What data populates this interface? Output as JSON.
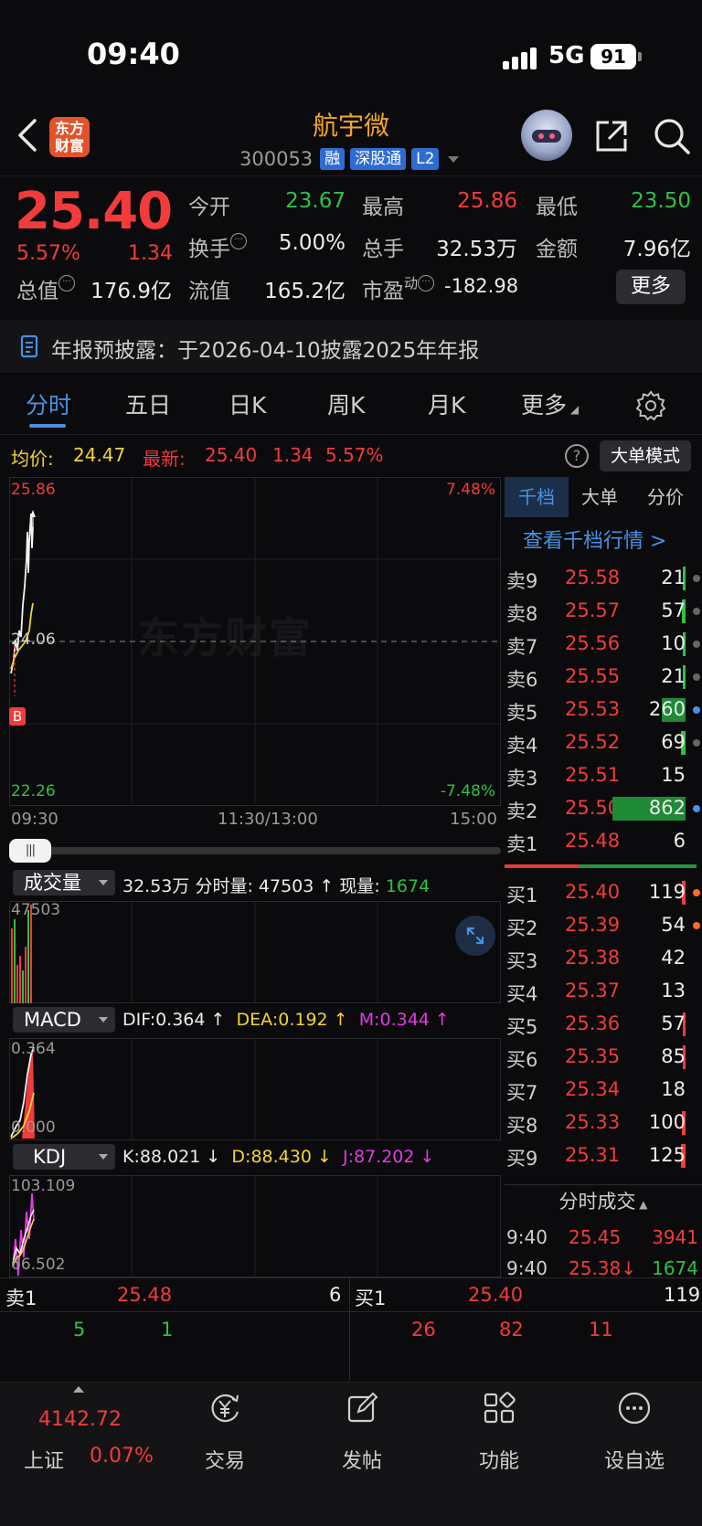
{
  "status_bar": {
    "time": "09:40",
    "network": "5G",
    "battery": "91"
  },
  "header": {
    "logo_line1": "东方",
    "logo_line2": "财富",
    "stock_name": "航宇微",
    "stock_code": "300053",
    "tags": [
      "融",
      "深股通",
      "L2"
    ]
  },
  "quote": {
    "price": "25.40",
    "change_pct": "5.57%",
    "change_abs": "1.34",
    "open_label": "今开",
    "open": "23.67",
    "high_label": "最高",
    "high": "25.86",
    "low_label": "最低",
    "low": "23.50",
    "turnover_label": "换手",
    "turnover": "5.00%",
    "volume_label": "总手",
    "volume": "32.53万",
    "amount_label": "金额",
    "amount": "7.96亿",
    "total_mv_label": "总值",
    "total_mv": "176.9亿",
    "float_mv_label": "流值",
    "float_mv": "165.2亿",
    "pe_label": "市盈",
    "pe_sup": "动",
    "pe": "-182.98",
    "more_label": "更多"
  },
  "announcement": {
    "text": "年报预披露：于2026-04-10披露2025年年报"
  },
  "tabs": [
    "分时",
    "五日",
    "日K",
    "周K",
    "月K",
    "更多"
  ],
  "info_row": {
    "avg_label": "均价:",
    "avg_value": "24.47",
    "latest_label": "最新:",
    "latest_price": "25.40",
    "latest_change": "1.34",
    "latest_pct": "5.57%",
    "help_icon": "?",
    "big_order_label": "大单模式"
  },
  "chart": {
    "y_top": "25.86",
    "y_mid": "24.06",
    "y_bottom": "22.26",
    "pct_top": "7.48%",
    "pct_bottom": "-7.48%",
    "watermark": "东方财富",
    "marker": "B",
    "t_start": "09:30",
    "t_mid": "11:30/13:00",
    "t_end": "15:00"
  },
  "volume_panel": {
    "selector": "成交量",
    "total": "32.53万",
    "minute_label": "分时量:",
    "minute_value": "47503 ↑",
    "current_label": "现量:",
    "current_value": "1674",
    "y_top": "47503"
  },
  "macd_panel": {
    "selector": "MACD",
    "dif": "DIF:0.364 ↑",
    "dea": "DEA:0.192 ↑",
    "m": "M:0.344 ↑",
    "y_top": "0.364",
    "y_bottom": "0.000"
  },
  "kdj_panel": {
    "selector": "KDJ",
    "k": "K:88.021 ↓",
    "d": "D:88.430 ↓",
    "j": "J:87.202 ↓",
    "y_top": "103.109",
    "y_bottom": "66.502"
  },
  "orderbook": {
    "tabs": [
      "千档",
      "大单",
      "分价"
    ],
    "link": "查看千档行情 >",
    "asks": [
      {
        "label": "卖9",
        "price": "25.58",
        "vol": "21"
      },
      {
        "label": "卖8",
        "price": "25.57",
        "vol": "57"
      },
      {
        "label": "卖7",
        "price": "25.56",
        "vol": "10"
      },
      {
        "label": "卖6",
        "price": "25.55",
        "vol": "21"
      },
      {
        "label": "卖5",
        "price": "25.53",
        "vol": "260"
      },
      {
        "label": "卖4",
        "price": "25.52",
        "vol": "69"
      },
      {
        "label": "卖3",
        "price": "25.51",
        "vol": "15"
      },
      {
        "label": "卖2",
        "price": "25.50",
        "vol": "862"
      },
      {
        "label": "卖1",
        "price": "25.48",
        "vol": "6"
      }
    ],
    "bids": [
      {
        "label": "买1",
        "price": "25.40",
        "vol": "119"
      },
      {
        "label": "买2",
        "price": "25.39",
        "vol": "54"
      },
      {
        "label": "买3",
        "price": "25.38",
        "vol": "42"
      },
      {
        "label": "买4",
        "price": "25.37",
        "vol": "13"
      },
      {
        "label": "买5",
        "price": "25.36",
        "vol": "57"
      },
      {
        "label": "买6",
        "price": "25.35",
        "vol": "85"
      },
      {
        "label": "买7",
        "price": "25.34",
        "vol": "18"
      },
      {
        "label": "买8",
        "price": "25.33",
        "vol": "100"
      },
      {
        "label": "买9",
        "price": "25.31",
        "vol": "125"
      }
    ],
    "ticks_header": "分时成交",
    "ticks": [
      {
        "time": "9:40",
        "price": "25.45",
        "vol": "3941"
      },
      {
        "time": "9:40",
        "price": "25.38↓",
        "vol": "1674"
      }
    ]
  },
  "level1": {
    "ask_label": "卖1",
    "ask_price": "25.48",
    "ask_vol": "6",
    "bid_label": "买1",
    "bid_price": "25.40",
    "bid_vol": "119",
    "ask_detail": [
      "5",
      "1"
    ],
    "bid_detail": [
      "26",
      "82",
      "11"
    ]
  },
  "bottom_nav": {
    "index_value": "4142.72",
    "index_name": "上证",
    "index_pct": "0.07%",
    "items": [
      "交易",
      "发帖",
      "功能",
      "设自选"
    ]
  }
}
